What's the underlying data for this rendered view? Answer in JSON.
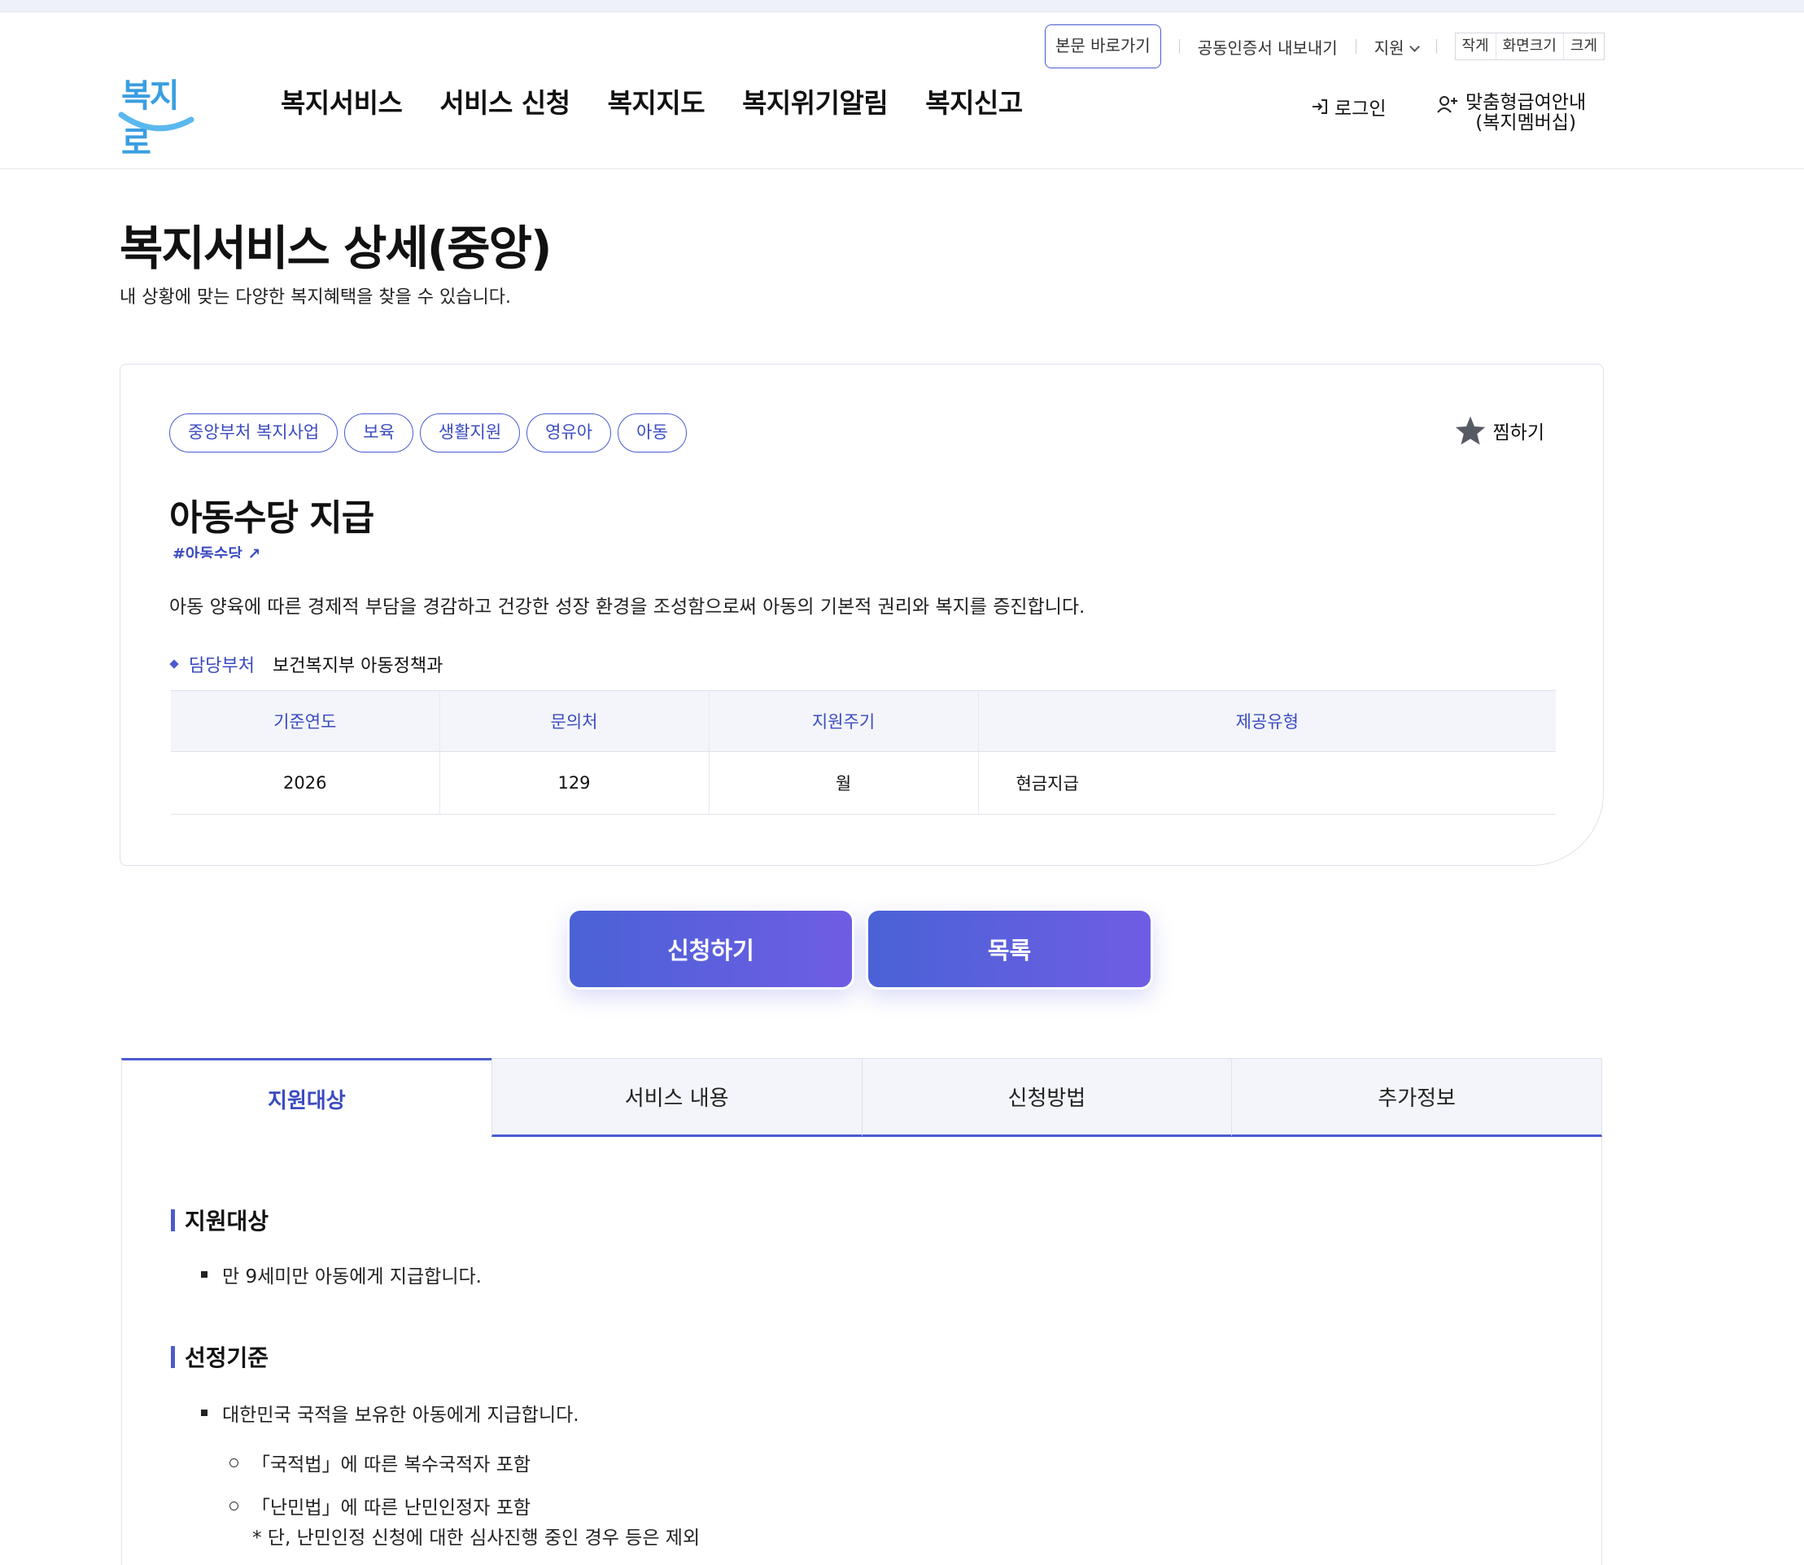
{
  "utility": {
    "skip_link": "본문 바로가기",
    "cert_export": "공동인증서 내보내기",
    "support": "지원",
    "font_small": "작게",
    "font_size": "화면크기",
    "font_large": "크게"
  },
  "header": {
    "logo_text": "복지로",
    "nav": [
      "복지서비스",
      "서비스 신청",
      "복지지도",
      "복지위기알림",
      "복지신고"
    ],
    "login": "로그인",
    "member_line1": "맞춤형급여안내",
    "member_line2": "(복지멤버십)"
  },
  "page": {
    "title": "복지서비스 상세(중앙)",
    "subtitle": "내 상황에 맞는 다양한 복지혜택을 찾을 수 있습니다."
  },
  "service": {
    "tags": [
      "중앙부처 복지사업",
      "보육",
      "생활지원",
      "영유아",
      "아동"
    ],
    "favorite_label": "찜하기",
    "title": "아동수당 지급",
    "hashtag": "#아동수당",
    "description": "아동 양육에 따른 경제적 부담을 경감하고 건강한 성장 환경을 조성함으로써 아동의 기본적 권리와 복지를 증진합니다.",
    "dept_label": "담당부처",
    "dept_value": "보건복지부 아동정책과",
    "table": {
      "headers": [
        "기준연도",
        "문의처",
        "지원주기",
        "제공유형"
      ],
      "row": [
        "2026",
        "129",
        "월",
        "현금지급"
      ]
    }
  },
  "actions": {
    "apply": "신청하기",
    "list": "목록"
  },
  "tabs": [
    "지원대상",
    "서비스 내용",
    "신청방법",
    "추가정보"
  ],
  "content": {
    "target_heading": "지원대상",
    "target_item": "만 9세미만 아동에게 지급합니다.",
    "criteria_heading": "선정기준",
    "criteria_item": "대한민국 국적을 보유한 아동에게 지급합니다.",
    "sub_items": [
      "「국적법」에 따른 복수국적자 포함",
      "「난민법」에 따른 난민인정자 포함"
    ],
    "note": "* 단, 난민인정 신청에 대한 심사진행 중인 경우 등은 제외"
  }
}
